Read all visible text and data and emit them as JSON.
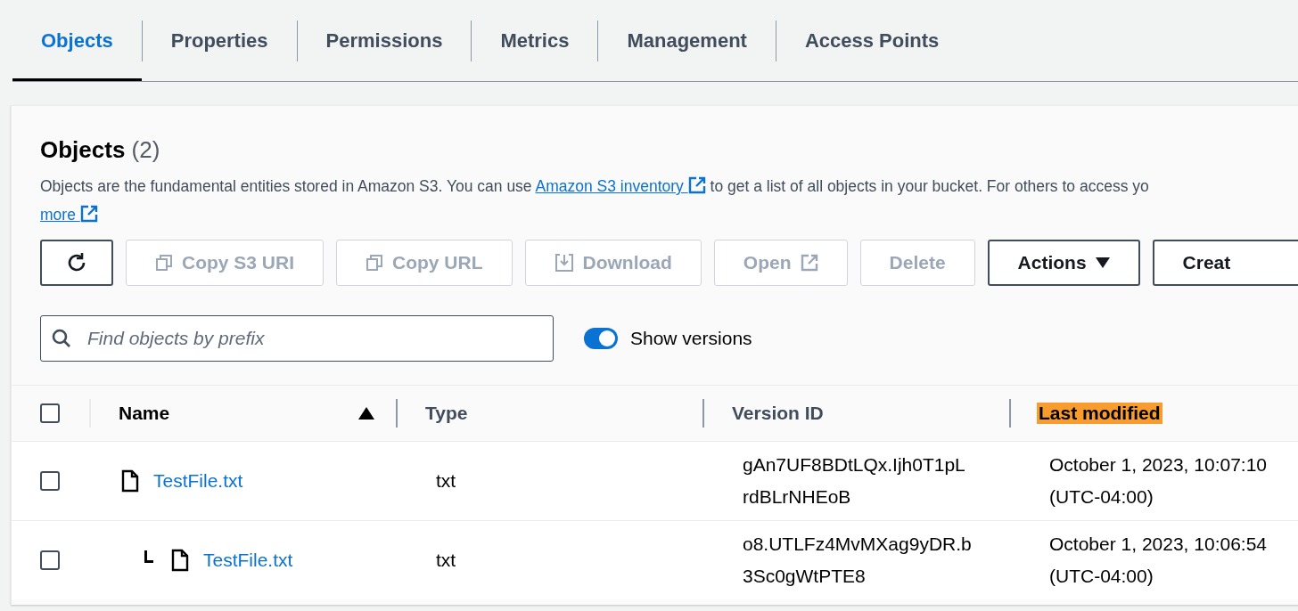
{
  "tabs": [
    {
      "label": "Objects",
      "selected": true
    },
    {
      "label": "Properties",
      "selected": false
    },
    {
      "label": "Permissions",
      "selected": false
    },
    {
      "label": "Metrics",
      "selected": false
    },
    {
      "label": "Management",
      "selected": false
    },
    {
      "label": "Access Points",
      "selected": false
    }
  ],
  "objects_panel": {
    "title": "Objects",
    "count": "(2)",
    "description": {
      "before": "Objects are the fundamental entities stored in Amazon S3. You can use ",
      "link": "Amazon S3 inventory ",
      "after": " to get a list of all objects in your bucket. For others to access yo",
      "more_link": "more "
    },
    "toolbar": [
      {
        "kind": "refresh",
        "disabled": false
      },
      {
        "kind": "copy",
        "label": "Copy S3 URI",
        "disabled": true
      },
      {
        "kind": "copy",
        "label": "Copy URL",
        "disabled": true
      },
      {
        "kind": "download",
        "label": "Download",
        "disabled": true
      },
      {
        "kind": "external",
        "label": "Open",
        "disabled": true
      },
      {
        "kind": "plain",
        "label": "Delete",
        "disabled": true
      },
      {
        "kind": "dropdown",
        "label": "Actions",
        "disabled": false
      },
      {
        "kind": "plain",
        "label": "Creat",
        "disabled": false
      }
    ],
    "search": {
      "placeholder": "Find objects by prefix"
    },
    "show_versions": {
      "label": "Show versions",
      "on": true
    },
    "table": {
      "select_all": {
        "checked": false
      },
      "columns": [
        {
          "label": "Name",
          "sorted": true,
          "highlighted": false
        },
        {
          "label": "Type",
          "sorted": false,
          "highlighted": false
        },
        {
          "label": "Version ID",
          "sorted": false,
          "highlighted": false
        },
        {
          "label": "Last modified",
          "sorted": false,
          "highlighted": true
        }
      ],
      "rows": [
        {
          "checked": false,
          "name": "TestFile.txt",
          "type": "txt",
          "version_id": [
            "gAn7UF8BDtLQx.Ijh0T1pL",
            "rdBLrNHEoB"
          ],
          "last_modified": [
            "October 1, 2023, 10:07:10",
            "(UTC-04:00)"
          ],
          "children": [
            {
              "checked": false,
              "name": "TestFile.txt",
              "type": "txt",
              "version_id": [
                "o8.UTLFz4MvMXag9yDR.b",
                "3Sc0gWtPTE8"
              ],
              "last_modified": [
                "October 1, 2023, 10:06:54",
                "(UTC-04:00)"
              ]
            }
          ]
        }
      ]
    }
  }
}
